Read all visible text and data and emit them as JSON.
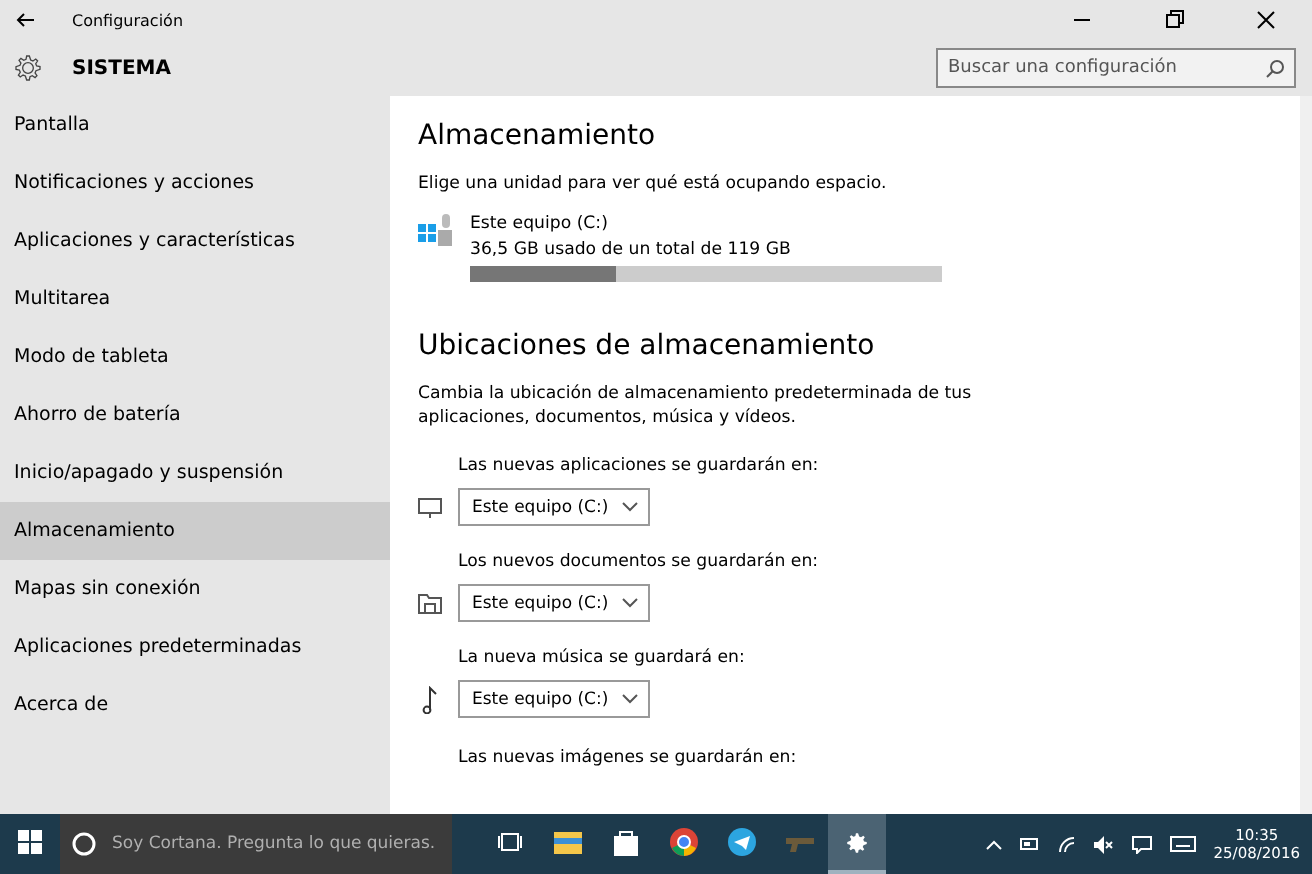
{
  "window": {
    "title": "Configuración"
  },
  "header": {
    "title": "SISTEMA",
    "search": {
      "placeholder": "Buscar una configuración"
    }
  },
  "sidebar": {
    "items": [
      {
        "label": "Pantalla",
        "selected": false
      },
      {
        "label": "Notificaciones y acciones",
        "selected": false
      },
      {
        "label": "Aplicaciones y características",
        "selected": false
      },
      {
        "label": "Multitarea",
        "selected": false
      },
      {
        "label": "Modo de tableta",
        "selected": false
      },
      {
        "label": "Ahorro de batería",
        "selected": false
      },
      {
        "label": "Inicio/apagado y suspensión",
        "selected": false
      },
      {
        "label": "Almacenamiento",
        "selected": true
      },
      {
        "label": "Mapas sin conexión",
        "selected": false
      },
      {
        "label": "Aplicaciones predeterminadas",
        "selected": false
      },
      {
        "label": "Acerca de",
        "selected": false
      }
    ]
  },
  "storage": {
    "title": "Almacenamiento",
    "description": "Elige una unidad para ver qué está ocupando espacio.",
    "drive": {
      "name": "Este equipo (C:)",
      "usage": "36,5 GB usado de un total de 119 GB",
      "level": 0.31
    }
  },
  "locations": {
    "title": "Ubicaciones de almacenamiento",
    "description": "Cambia la ubicación de almacenamiento predeterminada de tus aplicaciones, documentos, música y vídeos.",
    "items": [
      {
        "kind": "apps",
        "label": "Las nuevas aplicaciones se guardarán en:",
        "value": "Este equipo (C:)"
      },
      {
        "kind": "documents",
        "label": "Los nuevos documentos se guardarán en:",
        "value": "Este equipo (C:)"
      },
      {
        "kind": "music",
        "label": "La nueva música se guardará en:",
        "value": "Este equipo (C:)"
      },
      {
        "label": "Las nuevas imágenes se guardarán en:"
      }
    ]
  },
  "taskbar": {
    "cortana": {
      "placeholder": "Soy Cortana. Pregunta lo que quieras."
    },
    "apps": [
      {
        "kind": "taskview",
        "selected": false
      },
      {
        "kind": "explorer",
        "selected": false
      },
      {
        "kind": "store",
        "selected": false
      },
      {
        "kind": "chrome",
        "selected": false
      },
      {
        "kind": "telegram",
        "selected": false
      },
      {
        "kind": "game",
        "selected": false
      },
      {
        "kind": "settings",
        "selected": true
      }
    ],
    "time": "10:35",
    "date": "25/08/2016"
  }
}
